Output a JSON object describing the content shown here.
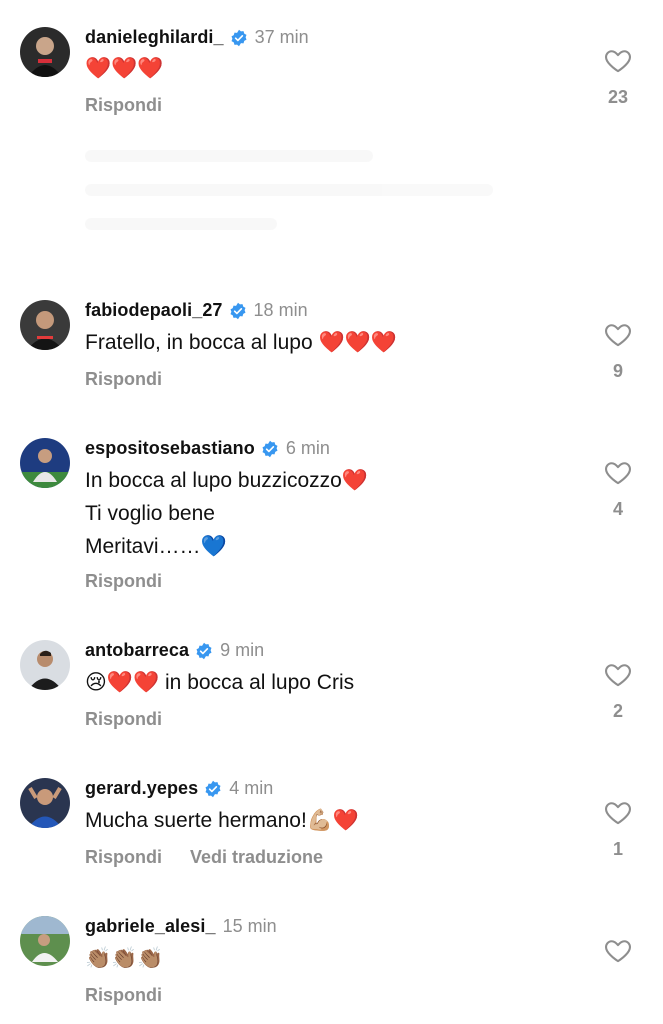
{
  "comments": [
    {
      "username": "danieleghilardi_",
      "verified": true,
      "time": "37 min",
      "text": "❤️❤️❤️",
      "likes": "23",
      "reply_label": "Rispondi",
      "avatar_color": "#1a1a1a"
    },
    {
      "username": "fabiodepaoli_27",
      "verified": true,
      "time": "18 min",
      "text": "Fratello, in bocca al lupo ❤️❤️❤️",
      "likes": "9",
      "reply_label": "Rispondi",
      "avatar_color": "#202020"
    },
    {
      "username": "espositosebastiano",
      "verified": true,
      "time": "6 min",
      "text": "In bocca al lupo buzzicozzo❤️\nTi voglio bene\nMeritavi……💙",
      "likes": "4",
      "reply_label": "Rispondi",
      "avatar_color": "#1f3f8a"
    },
    {
      "username": "antobarreca",
      "verified": true,
      "time": "9 min",
      "text": "😢❤️❤️ in bocca al lupo Cris",
      "likes": "2",
      "reply_label": "Rispondi",
      "avatar_color": "#3a3a3a"
    },
    {
      "username": "gerard.yepes",
      "verified": true,
      "time": "4 min",
      "text": "Mucha suerte hermano!💪🏼❤️",
      "likes": "1",
      "reply_label": "Rispondi",
      "translate_label": "Vedi traduzione",
      "avatar_color": "#1f4fa8"
    },
    {
      "username": "gabriele_alesi_",
      "verified": false,
      "time": "15 min",
      "text": "👏🏽👏🏽👏🏽",
      "likes": "",
      "reply_label": "Rispondi",
      "avatar_color": "#2d6b3a"
    }
  ],
  "colors": {
    "verified_blue": "#3897f0",
    "secondary_text": "#8e8e8e",
    "heart_outline": "#8e8e8e"
  },
  "icons": {
    "like": "heart-outline-icon",
    "verified": "verified-badge-icon"
  }
}
